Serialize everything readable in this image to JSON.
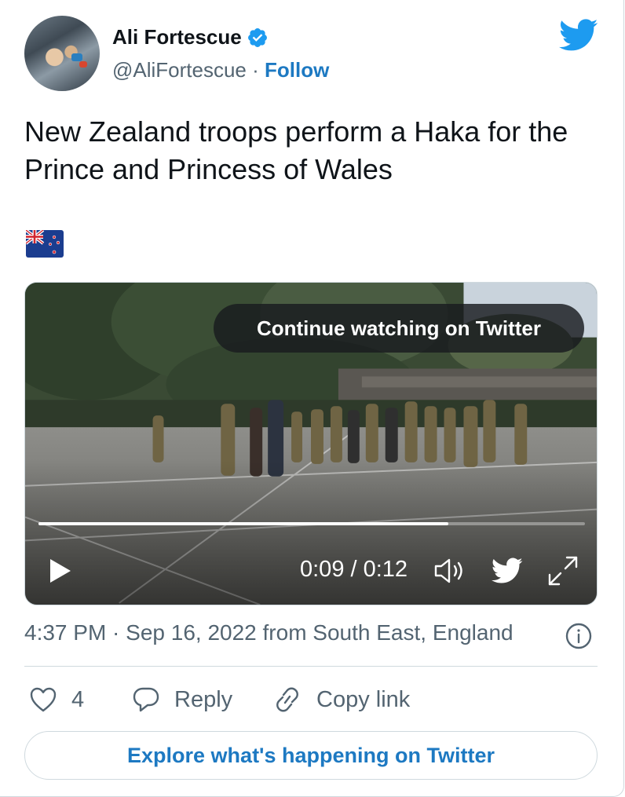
{
  "author": {
    "name": "Ali Fortescue",
    "handle": "@AliFortescue",
    "separator": "·",
    "follow_label": "Follow"
  },
  "tweet": {
    "text": "New Zealand troops perform a Haka for the Prince and Princess of Wales",
    "emoji_flag": "new-zealand-flag"
  },
  "video": {
    "overlay_label": "Continue watching on Twitter",
    "time_display": "0:09 / 0:12",
    "progress": 0.75
  },
  "meta": {
    "timestamp": "4:37 PM · Sep 16, 2022 from South East, England"
  },
  "actions": {
    "like_count": "4",
    "reply_label": "Reply",
    "copy_link_label": "Copy link"
  },
  "footer": {
    "explore_label": "Explore what's happening on Twitter"
  },
  "colors": {
    "link_blue": "#1d79c2",
    "twitter_blue": "#1d9bf0",
    "secondary_text": "#536471",
    "border": "#cfd9de"
  }
}
